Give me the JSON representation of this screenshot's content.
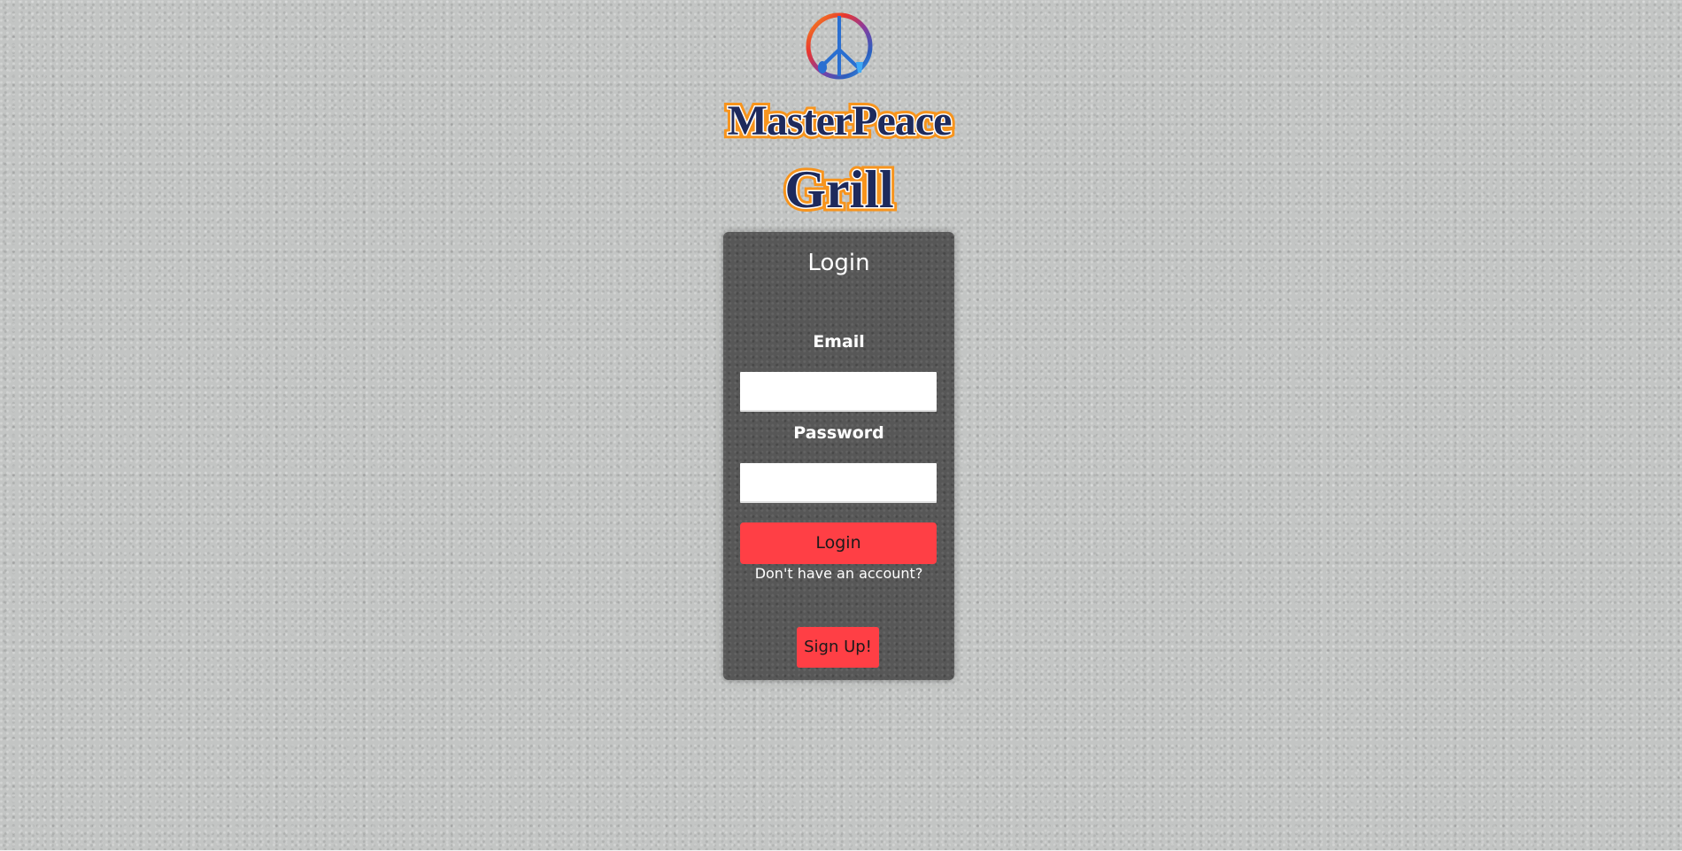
{
  "logo": {
    "line1": "MasterPeace",
    "line2": "Grill",
    "icon": "peace-sign-icon"
  },
  "login_card": {
    "title": "Login",
    "email_label": "Email",
    "email_value": "",
    "password_label": "Password",
    "password_value": "",
    "login_button": "Login",
    "no_account_text": "Don't have an account?",
    "signup_button": "Sign Up!"
  },
  "colors": {
    "background": "#c3c5c4",
    "card_background": "#575757",
    "button_red": "#ff3f45",
    "logo_text_fill": "#1e2a5c",
    "logo_text_outline_orange": "#f7941d",
    "text_white": "#ffffff"
  }
}
